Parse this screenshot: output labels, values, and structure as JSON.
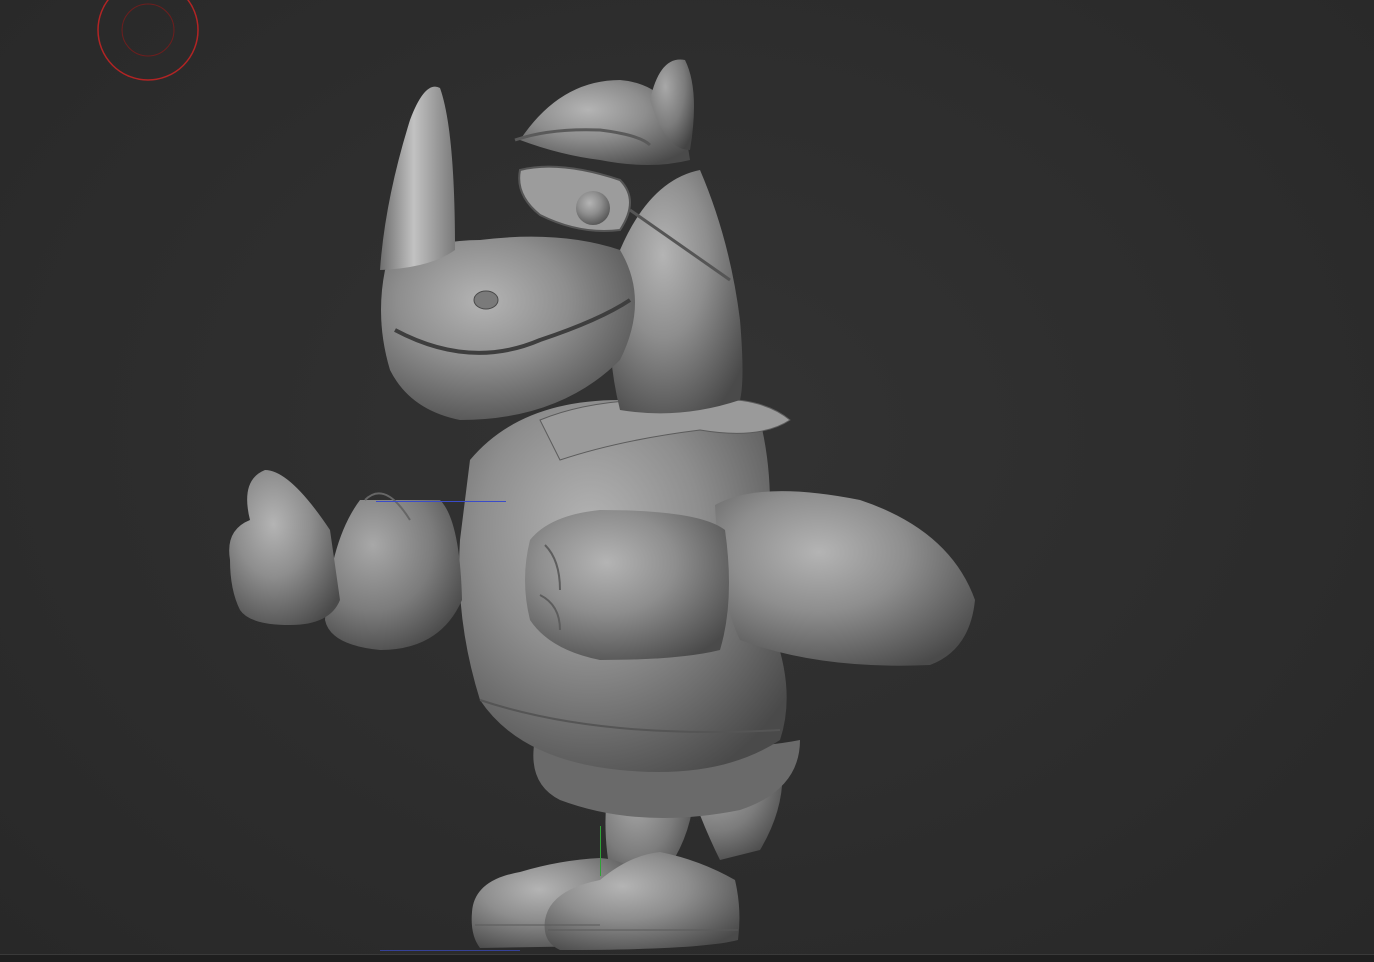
{
  "viewport": {
    "background_color": "#2c2c2c",
    "model_color": "#8c8c8c",
    "brush_cursor_color": "#b22424",
    "gizmo_x_color": "#3a4cc8",
    "gizmo_y_color": "#2ea336"
  },
  "icons": [
    "brush-cursor-icon",
    "rhino-sculpt-model",
    "axis-x-line",
    "axis-y-line"
  ]
}
